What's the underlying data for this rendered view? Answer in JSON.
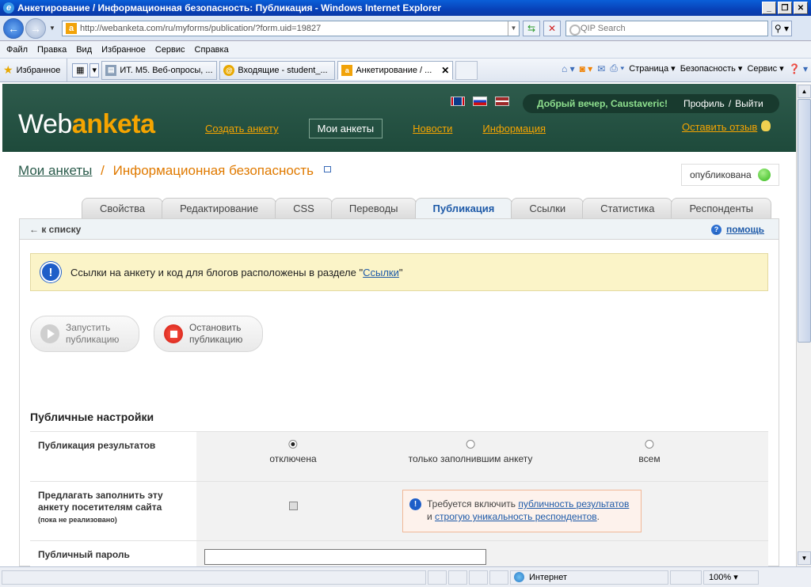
{
  "browser": {
    "title": "Анкетирование / Информационная безопасность: Публикация - Windows Internet Explorer",
    "url": "http://webanketa.com/ru/myforms/publication/?form.uid=19827",
    "search_placeholder": "QIP Search",
    "menu": [
      "Файл",
      "Правка",
      "Вид",
      "Избранное",
      "Сервис",
      "Справка"
    ],
    "favorites_label": "Избранное",
    "tabs": [
      {
        "label": "ИТ. М5. Веб-опросы, ..."
      },
      {
        "label": "Входящие - student_..."
      },
      {
        "label": "Анкетирование / ..."
      }
    ],
    "commands": [
      "Страница",
      "Безопасность",
      "Сервис"
    ],
    "status_zone": "Интернет",
    "zoom": "100%"
  },
  "site": {
    "logo_left": "Web",
    "logo_right": "anketa",
    "nav": [
      "Создать анкету",
      "Мои анкеты",
      "Новости",
      "Информация"
    ],
    "greeting": "Добрый вечер, Caustaveric!",
    "profile": "Профиль",
    "slash": "/",
    "logout": "Выйти",
    "feedback": "Оставить отзыв"
  },
  "breadcrumb": {
    "root": "Мои анкеты",
    "sep": "/",
    "current": "Информационная безопасность"
  },
  "form_status": "опубликована",
  "page_tabs": [
    "Свойства",
    "Редактирование",
    "CSS",
    "Переводы",
    "Публикация",
    "Ссылки",
    "Статистика",
    "Респонденты"
  ],
  "back_link": "← к списку",
  "help": "помощь",
  "notice": {
    "text_before": "Ссылки на анкету и код для блогов расположены в разделе \"",
    "link": "Ссылки",
    "text_after": "\""
  },
  "buttons": {
    "start_l1": "Запустить",
    "start_l2": "публикацию",
    "stop_l1": "Остановить",
    "stop_l2": "публикацию"
  },
  "section_title": "Публичные настройки",
  "settings": {
    "results_label": "Публикация результатов",
    "results_options": [
      "отключена",
      "только заполнившим анкету",
      "всем"
    ],
    "results_selected": "отключена",
    "offer_label": "Предлагать заполнить эту анкету посетителям сайта",
    "offer_note": "(пока не реализовано)",
    "hint_before": "Требуется включить",
    "hint_link1": "публичность результатов",
    "hint_and": "и",
    "hint_link2": "строгую уникальность респондентов",
    "hint_dot": ".",
    "password_label": "Публичный пароль",
    "password_value": ""
  }
}
